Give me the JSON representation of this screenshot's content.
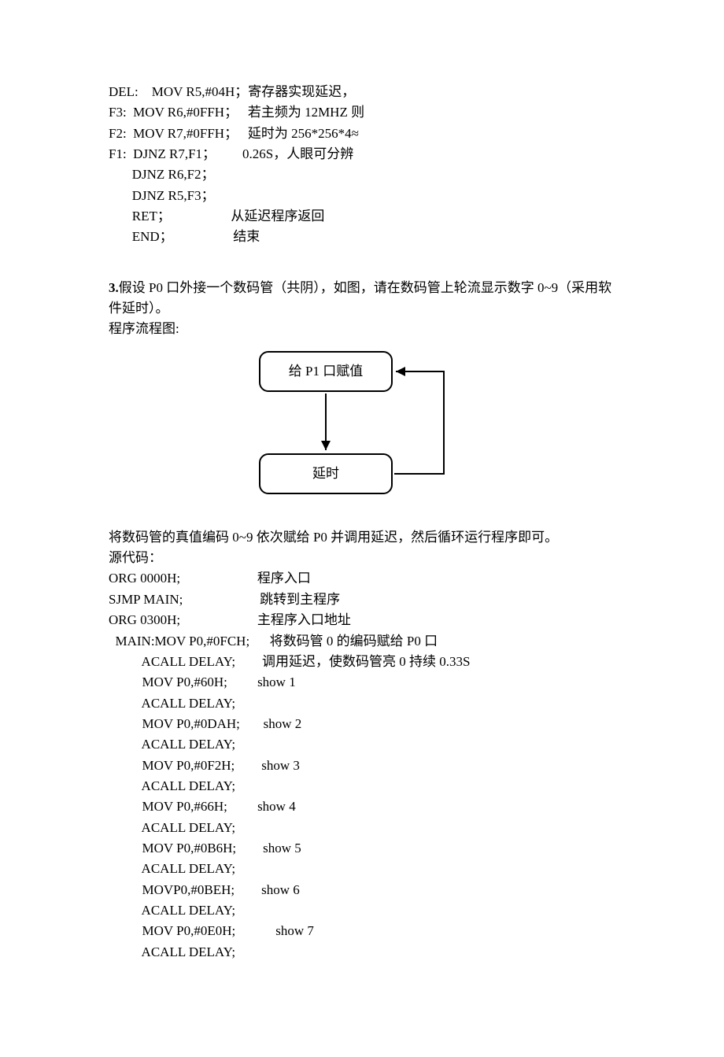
{
  "code_block1": {
    "lines": [
      "DEL:    MOV R5,#04H；寄存器实现延迟，",
      "F3:  MOV R6,#0FFH；   若主频为 12MHZ 则",
      "F2:  MOV R7,#0FFH；   延时为 256*256*4≈",
      "F1:  DJNZ R7,F1；        0.26S，人眼可分辨",
      "       DJNZ R6,F2；",
      "       DJNZ R5,F3；",
      "       RET；                  从延迟程序返回",
      "       END；                  结束"
    ]
  },
  "question3": {
    "prefix": "3.",
    "text": "假设 P0 口外接一个数码管（共阴），如图，请在数码管上轮流显示数字 0~9（采用软件延时）。",
    "flow_label": "程序流程图:"
  },
  "flowchart": {
    "box1": "给 P1 口赋值",
    "box2": "延时"
  },
  "explanation": {
    "line1": "将数码管的真值编码 0~9 依次赋给 P0 并调用延迟，然后循环运行程序即可。",
    "line2": "源代码："
  },
  "code_block2": {
    "lines": [
      "ORG 0000H;                       程序入口",
      "SJMP MAIN;                       跳转到主程序",
      "ORG 0300H;                       主程序入口地址",
      "  MAIN:MOV P0,#0FCH;      将数码管 0 的编码赋给 P0 口",
      "          ACALL DELAY;        调用延迟，使数码管亮 0 持续 0.33S",
      "          MOV P0,#60H;         show 1",
      "          ACALL DELAY;",
      "          MOV P0,#0DAH;       show 2",
      "          ACALL DELAY;",
      "          MOV P0,#0F2H;        show 3",
      "          ACALL DELAY;",
      "          MOV P0,#66H;         show 4",
      "          ACALL DELAY;",
      "          MOV P0,#0B6H;        show 5",
      "          ACALL DELAY;",
      "          MOVP0,#0BEH;        show 6",
      "          ACALL DELAY;",
      "          MOV P0,#0E0H;            show 7",
      "          ACALL DELAY;"
    ]
  }
}
